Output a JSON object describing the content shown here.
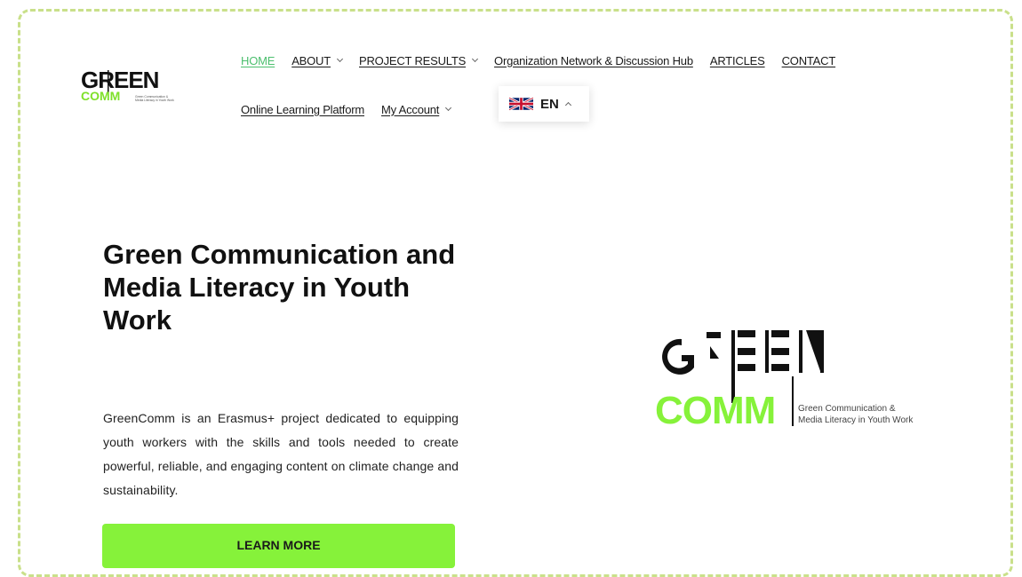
{
  "brand": {
    "logo_word_top": "GREEN",
    "logo_word_bottom": "COMM",
    "tagline_line1": "Green Communication &",
    "tagline_line2": "Media Literacy in Youth Work",
    "accent_color": "#86f23a",
    "active_nav_color": "#4cbf6e"
  },
  "nav": {
    "home": "HOME",
    "about": "ABOUT",
    "project_results": "PROJECT RESULTS",
    "network_hub": "Organization Network & Discussion Hub",
    "articles": "ARTICLES",
    "contact": "CONTACT",
    "learning_platform": "Online Learning Platform",
    "my_account": "My Account"
  },
  "language": {
    "code": "EN",
    "flag_icon": "uk-flag-icon"
  },
  "hero": {
    "title": "Green Communication and Media Literacy in Youth Work",
    "description": "GreenComm is an Erasmus+ project dedicated to equipping youth workers with the skills and tools needed to create powerful, reliable, and engaging content on climate change and sustainability.",
    "cta_label": "LEARN MORE"
  }
}
